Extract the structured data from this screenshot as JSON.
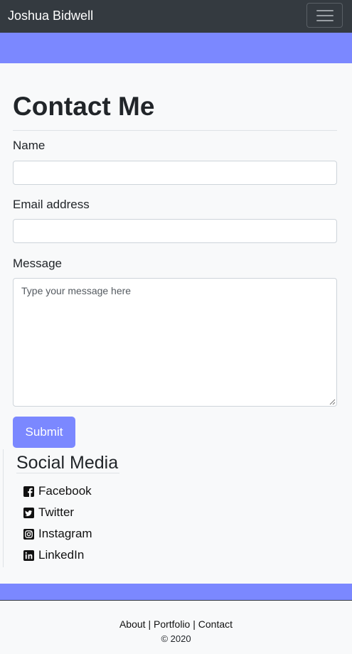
{
  "navbar": {
    "brand": "Joshua Bidwell",
    "toggle_icon": "hamburger-icon"
  },
  "colors": {
    "navbar": "#343a40",
    "accent": "#7b88ff",
    "page": "#f8f9fa"
  },
  "contact": {
    "title": "Contact Me",
    "name_label": "Name",
    "name_value": "",
    "email_label": "Email address",
    "email_value": "",
    "message_label": "Message",
    "message_placeholder": "Type your message here",
    "submit_label": "Submit"
  },
  "social": {
    "title": "Social Media",
    "items": [
      {
        "label": "Facebook",
        "icon": "facebook-icon"
      },
      {
        "label": "Twitter",
        "icon": "twitter-icon"
      },
      {
        "label": "Instagram",
        "icon": "instagram-icon"
      },
      {
        "label": "LinkedIn",
        "icon": "linkedin-icon"
      }
    ]
  },
  "footer": {
    "links": [
      "About",
      "Portfolio",
      "Contact"
    ],
    "separator": "|",
    "copyright": "© 2020"
  }
}
